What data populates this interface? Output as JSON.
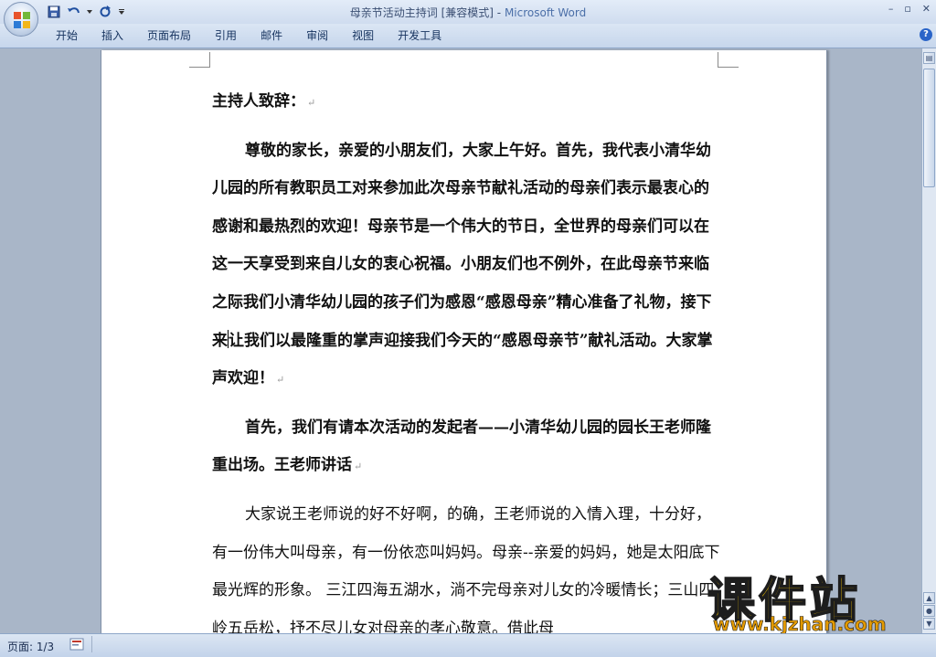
{
  "window": {
    "title_doc": "母亲节活动主持词 [兼容模式]",
    "title_sep": " - ",
    "title_app": "Microsoft Word",
    "minimize": "–",
    "maximize": "▫",
    "close": "✕"
  },
  "ribbon": {
    "tabs": [
      "开始",
      "插入",
      "页面布局",
      "引用",
      "邮件",
      "审阅",
      "视图",
      "开发工具"
    ]
  },
  "document": {
    "p1": "主持人致辞：",
    "p2": "尊敬的家长，亲爱的小朋友们，大家上午好。首先，我代表小清华幼儿园的所有教职员工对来参加此次母亲节献礼活动的母亲们表示最衷心的感谢和最热烈的欢迎！母亲节是一个伟大的节日，全世界的母亲们可以在这一天享受到来自儿女的衷心祝福。小朋友们也不例外，在此母亲节来临之际我们小清华幼儿园的孩子们为感恩“感恩母亲”精心准备了礼物，接下来",
    "p2b": "让我们以最隆重的掌声迎接我们今天的“感恩母亲节”献礼活动。大家掌声欢迎！",
    "p3": "首先，我们有请本次活动的发起者——小清华幼儿园的园长王老师隆重出场。王老师讲话",
    "p4": "大家说王老师说的好不好啊，的确，王老师说的入情入理，十分好，有一份伟大叫母亲，有一份依恋叫妈妈。母亲--亲爱的妈妈，她是太阳底下最光辉的形象。  三江四海五湖水，淌不完母亲对儿女的冷暖情长；三山四岭五岳松，抒不尽儿女对母亲的孝心敬意。借此母"
  },
  "watermark": {
    "big": "课件站",
    "url": "www.kjzhan.com"
  },
  "status": {
    "page": "页面: 1/3"
  },
  "help_label": "?"
}
